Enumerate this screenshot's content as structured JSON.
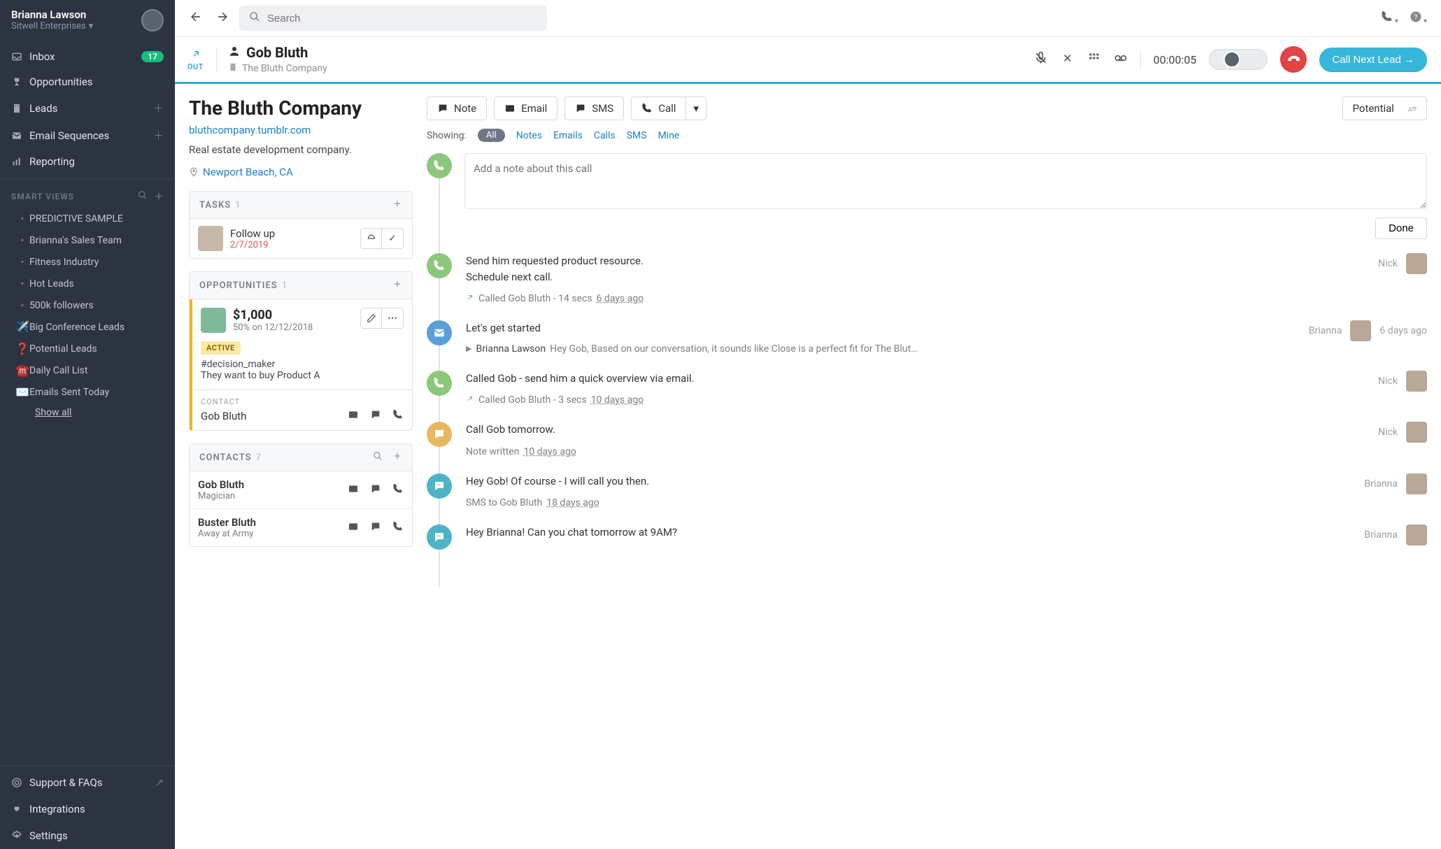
{
  "user": {
    "name": "Brianna Lawson",
    "org": "Sitwell Enterprises"
  },
  "nav": {
    "inbox": "Inbox",
    "inbox_count": "17",
    "opportunities": "Opportunities",
    "leads": "Leads",
    "sequences": "Email Sequences",
    "reporting": "Reporting"
  },
  "smartviews": {
    "title": "SMART VIEWS",
    "items": [
      {
        "icon": "dot",
        "label": "PREDICTIVE SAMPLE"
      },
      {
        "icon": "dot",
        "label": "Brianna's Sales Team"
      },
      {
        "icon": "dot",
        "label": "Fitness Industry"
      },
      {
        "icon": "dot",
        "label": "Hot Leads"
      },
      {
        "icon": "dot",
        "label": "500k followers"
      },
      {
        "icon": "✈️",
        "label": "Big Conference Leads"
      },
      {
        "icon": "❓",
        "label": "Potential Leads"
      },
      {
        "icon": "☎️",
        "label": "Daily Call List"
      },
      {
        "icon": "✉️",
        "label": "Emails Sent Today"
      }
    ],
    "showall": "Show all"
  },
  "footer_nav": {
    "support": "Support & FAQs",
    "integrations": "Integrations",
    "settings": "Settings"
  },
  "search_placeholder": "Search",
  "call": {
    "direction": "OUT",
    "contact": "Gob Bluth",
    "company": "The Bluth Company",
    "timer": "00:00:05",
    "next_lead": "Call Next Lead →"
  },
  "lead": {
    "name": "The Bluth Company",
    "url": "bluthcompany.tumblr.com",
    "desc": "Real estate development company.",
    "location": "Newport Beach, CA"
  },
  "tasks": {
    "title": "TASKS",
    "count": "1",
    "items": [
      {
        "title": "Follow up",
        "date": "2/7/2019"
      }
    ]
  },
  "opps": {
    "title": "OPPORTUNITIES",
    "count": "1",
    "items": [
      {
        "amount": "$1,000",
        "meta": "50% on 12/12/2018",
        "status": "ACTIVE",
        "note1": "#decision_maker",
        "note2": "They want to buy Product A",
        "contact_label": "CONTACT",
        "contact_name": "Gob Bluth"
      }
    ]
  },
  "contacts": {
    "title": "CONTACTS",
    "count": "7",
    "items": [
      {
        "name": "Gob Bluth",
        "role": "Magician"
      },
      {
        "name": "Buster Bluth",
        "role": "Away at Army"
      }
    ]
  },
  "actions": {
    "note": "Note",
    "email": "Email",
    "sms": "SMS",
    "call": "Call",
    "status": "Potential"
  },
  "filters": {
    "label": "Showing:",
    "all": "All",
    "notes": "Notes",
    "emails": "Emails",
    "calls": "Calls",
    "sms": "SMS",
    "mine": "Mine"
  },
  "note_input": {
    "placeholder": "Add a note about this call",
    "done": "Done"
  },
  "timeline": [
    {
      "kind": "call",
      "body1": "Send him requested product resource.",
      "body2": "Schedule next call.",
      "meta": "Called Gob Bluth - 14 secs",
      "meta_when": "6 days ago",
      "who": "Nick"
    },
    {
      "kind": "mail",
      "body1": "Let's get started",
      "sender": "Brianna Lawson",
      "snippet": "Hey Gob, Based on our conversation, it sounds like Close is a perfect fit for The Blut…",
      "who": "Brianna",
      "when": "6 days ago"
    },
    {
      "kind": "call",
      "body1": "Called Gob - send him a quick overview via email.",
      "meta": "Called Gob Bluth - 3 secs",
      "meta_when": "10 days ago",
      "who": "Nick"
    },
    {
      "kind": "note",
      "body1": "Call Gob tomorrow.",
      "meta": "Note written",
      "meta_when": "10 days ago",
      "who": "Nick"
    },
    {
      "kind": "sms",
      "body1": "Hey Gob! Of course - I will call you then.",
      "meta": "SMS to Gob Bluth",
      "meta_when": "18 days ago",
      "who": "Brianna"
    },
    {
      "kind": "sms",
      "body1": "Hey Brianna! Can you chat tomorrow at 9AM?",
      "who": "Brianna"
    }
  ]
}
